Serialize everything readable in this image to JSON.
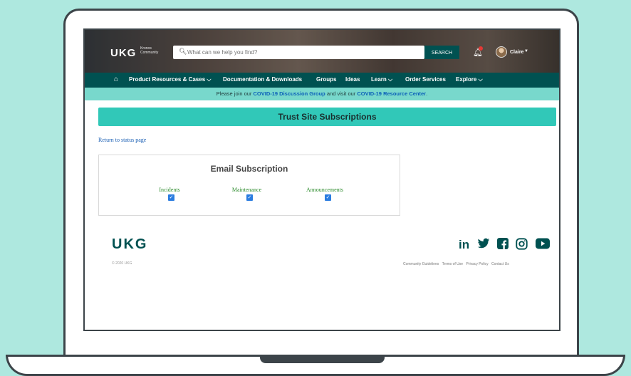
{
  "header": {
    "logo": "UKG",
    "logo_sub": "Kronos Community",
    "search_placeholder": "What can we help you find?",
    "search_button": "SEARCH",
    "user_name": "Claire"
  },
  "nav": {
    "items": [
      {
        "label": "Product Resources & Cases ⌵"
      },
      {
        "label": "Documentation & Downloads"
      },
      {
        "label": "Groups"
      },
      {
        "label": "Ideas"
      },
      {
        "label": "Learn ⌵"
      },
      {
        "label": "Order Services"
      },
      {
        "label": "Explore ⌵"
      }
    ]
  },
  "banner": {
    "prefix": "Please join our ",
    "group_link": "COVID-19 Discussion Group",
    "middle": " and visit our ",
    "center_link": "COVID-19 Resource Center",
    "suffix": "."
  },
  "page": {
    "title": "Trust Site Subscriptions",
    "return_link": "Return to status page",
    "subscription_title": "Email Subscription",
    "options": [
      {
        "label": "Incidents",
        "checked": true
      },
      {
        "label": "Maintenance",
        "checked": true
      },
      {
        "label": "Announcements",
        "checked": true
      }
    ]
  },
  "footer": {
    "logo": "UKG",
    "copyright": "© 2020 UKG",
    "links": [
      "Community Guidelines",
      "Terms of Use",
      "Privacy Policy",
      "Contact Us"
    ],
    "social_icons": [
      "linkedin-icon",
      "twitter-icon",
      "facebook-icon",
      "instagram-icon",
      "youtube-icon"
    ]
  },
  "colors": {
    "background": "#aee8df",
    "brand_dark": "#005151",
    "banner": "#78d8cc",
    "title_bar": "#31c8b8"
  }
}
